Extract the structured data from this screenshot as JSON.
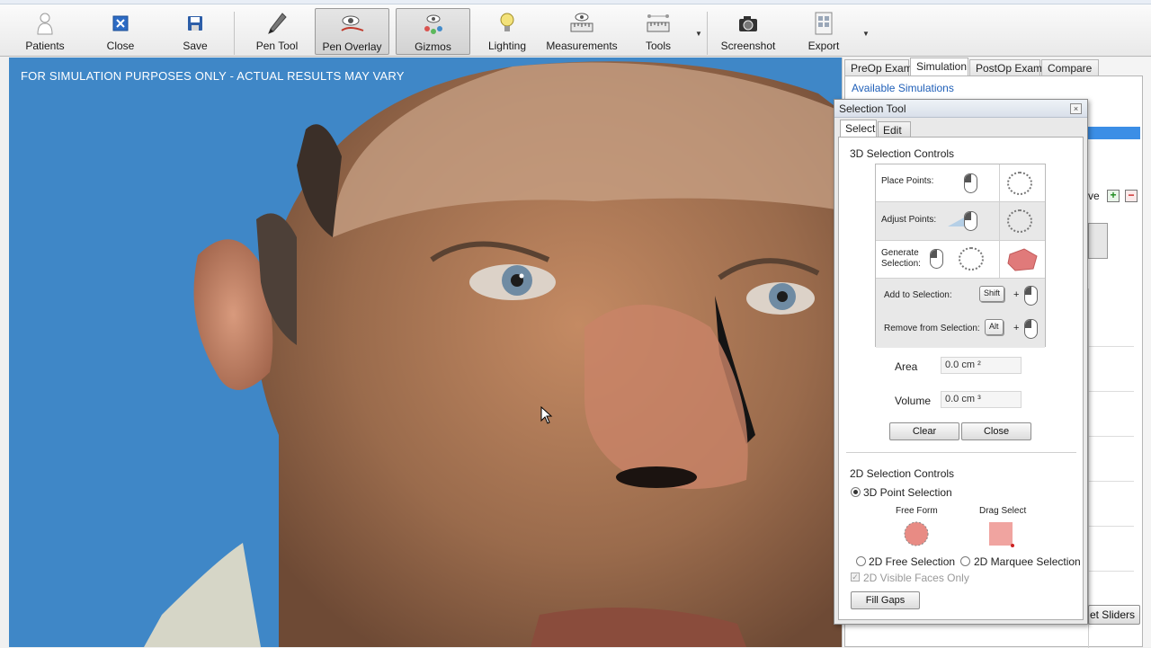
{
  "toolbar": {
    "items": [
      {
        "label": "Patients",
        "icon": "person-icon"
      },
      {
        "label": "Close",
        "icon": "close-doc-icon"
      },
      {
        "label": "Save",
        "icon": "floppy-icon"
      },
      {
        "label": "Pen Tool",
        "icon": "pen-icon"
      },
      {
        "label": "Pen Overlay",
        "icon": "pen-overlay-icon",
        "active": true
      },
      {
        "label": "Gizmos",
        "icon": "gizmos-icon",
        "active": true
      },
      {
        "label": "Lighting",
        "icon": "lightbulb-icon"
      },
      {
        "label": "Measurements",
        "icon": "ruler-icon"
      },
      {
        "label": "Tools",
        "icon": "tools-icon"
      },
      {
        "label": "Screenshot",
        "icon": "camera-icon"
      },
      {
        "label": "Export",
        "icon": "export-icon"
      }
    ]
  },
  "viewport": {
    "disclaimer": "FOR SIMULATION PURPOSES ONLY - ACTUAL RESULTS MAY VARY",
    "background_color": "#3f87c7"
  },
  "right_panel": {
    "tabs": [
      "PreOp Exam",
      "Simulation",
      "PostOp Exam",
      "Compare"
    ],
    "active_tab": "Simulation",
    "available_simulations_label": "Available Simulations",
    "partial_label": "ve",
    "reset_button_partial": "et Sliders"
  },
  "dialog": {
    "title": "Selection Tool",
    "tabs": [
      "Select",
      "Edit"
    ],
    "active_tab": "Select",
    "section_3d_title": "3D Selection Controls",
    "place_points": "Place Points:",
    "adjust_points": "Adjust Points:",
    "generate_selection_line1": "Generate",
    "generate_selection_line2": "Selection:",
    "add_to_selection": "Add to Selection:",
    "remove_from_selection": "Remove from Selection:",
    "shift_key": "Shift",
    "alt_key": "Alt",
    "plus": "+",
    "area_label": "Area",
    "area_value": "0.0 cm ²",
    "volume_label": "Volume",
    "volume_value": "0.0 cm ³",
    "clear_button": "Clear",
    "close_button": "Close",
    "section_2d_title": "2D Selection Controls",
    "point_selection_label": "3D Point Selection",
    "free_form_label": "Free Form",
    "drag_select_label": "Drag Select",
    "free_selection_label": "2D Free Selection",
    "marquee_selection_label": "2D Marquee Selection",
    "visible_faces_label": "2D Visible Faces Only",
    "fill_gaps_button": "Fill Gaps"
  }
}
